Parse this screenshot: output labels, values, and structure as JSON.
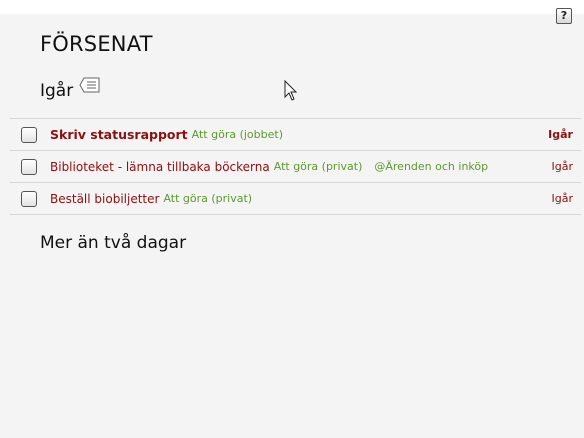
{
  "help": {
    "label": "?"
  },
  "page": {
    "title": "FÖRSENAT"
  },
  "sections": {
    "yesterday": {
      "title": "Igår"
    },
    "later": {
      "title": "Mer än två dagar"
    }
  },
  "tasks": [
    {
      "title": "Skriv statusrapport",
      "list": "Att göra (jobbet)",
      "tag": "",
      "due": "Igår",
      "bold": true
    },
    {
      "title": "Biblioteket - lämna tillbaka böckerna",
      "list": "Att göra (privat)",
      "tag": "@Ärenden och inköp",
      "due": "Igår",
      "bold": false
    },
    {
      "title": "Beställ biobiljetter",
      "list": "Att göra (privat)",
      "tag": "",
      "due": "Igår",
      "bold": false
    }
  ],
  "icons": {
    "help": "question-mark-icon",
    "note": "note-icon",
    "checkbox": "checkbox-icon",
    "cursor": "mouse-pointer-icon"
  },
  "colors": {
    "task_title": "#8b1010",
    "list_name": "#5c9a2c",
    "background": "#f4f4f4"
  }
}
